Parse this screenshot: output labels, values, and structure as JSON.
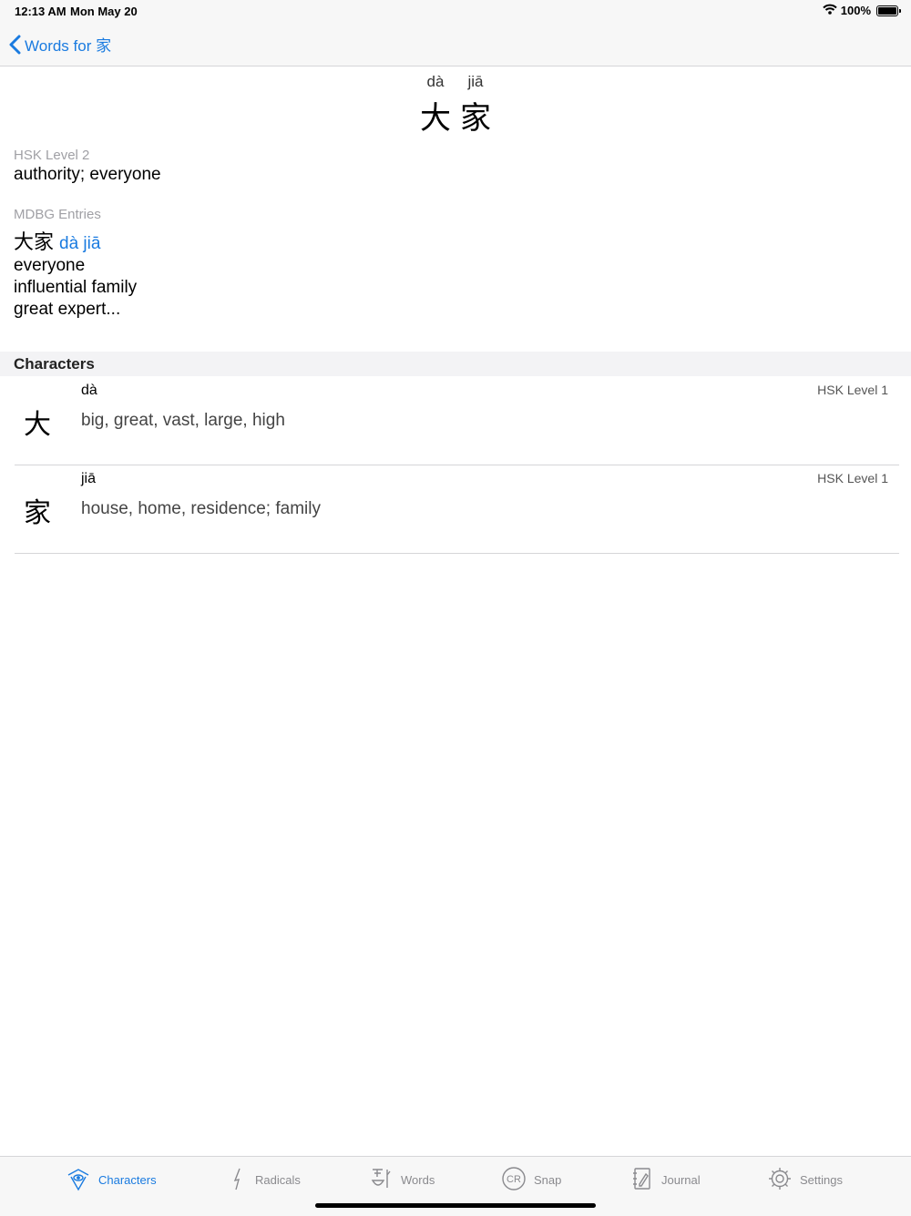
{
  "status": {
    "time": "12:13 AM",
    "date": "Mon May 20",
    "battery": "100%"
  },
  "nav": {
    "back_label": "Words for 家"
  },
  "word": {
    "syllables": [
      {
        "pinyin": "dà",
        "hanzi": "大"
      },
      {
        "pinyin": "jiā",
        "hanzi": "家"
      }
    ]
  },
  "hsk": {
    "label": "HSK Level 2",
    "definition": "authority; everyone"
  },
  "mdbg": {
    "label": "MDBG Entries",
    "hanzi": "大家",
    "pinyin": "dà jiā",
    "definitions": [
      "everyone",
      "influential family",
      "great expert..."
    ]
  },
  "characters": {
    "title": "Characters",
    "rows": [
      {
        "hanzi": "大",
        "pinyin": "dà",
        "hsk": "HSK Level 1",
        "definition": "big, great, vast, large, high"
      },
      {
        "hanzi": "家",
        "pinyin": "jiā",
        "hsk": "HSK Level 1",
        "definition": "house, home, residence; family"
      }
    ]
  },
  "tabs": [
    {
      "label": "Characters",
      "icon": "characters-icon",
      "active": true
    },
    {
      "label": "Radicals",
      "icon": "radicals-icon",
      "active": false
    },
    {
      "label": "Words",
      "icon": "words-icon",
      "active": false
    },
    {
      "label": "Snap",
      "icon": "snap-icon",
      "active": false
    },
    {
      "label": "Journal",
      "icon": "journal-icon",
      "active": false
    },
    {
      "label": "Settings",
      "icon": "settings-icon",
      "active": false
    }
  ],
  "colors": {
    "accent": "#1a7be0",
    "tab_inactive": "#8a8a8e",
    "bar_bg": "#f7f7f7"
  }
}
